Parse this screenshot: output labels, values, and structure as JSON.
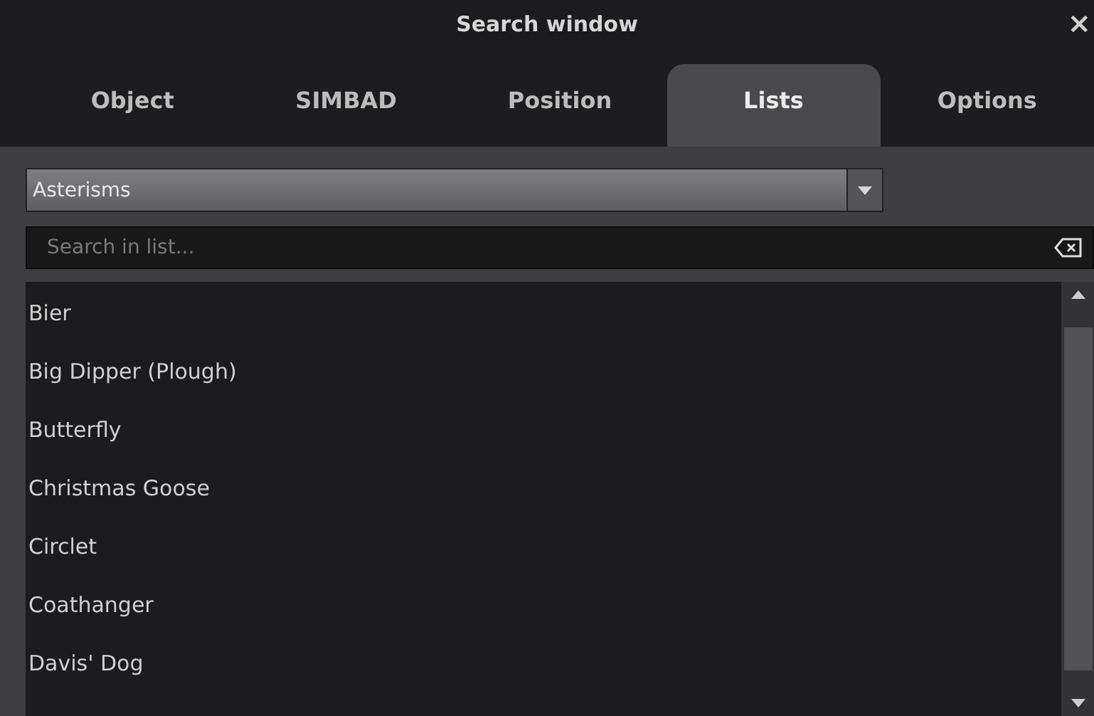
{
  "window": {
    "title": "Search window",
    "close": "×"
  },
  "tabs": [
    {
      "label": "Object",
      "selected": false
    },
    {
      "label": "SIMBAD",
      "selected": false
    },
    {
      "label": "Position",
      "selected": false
    },
    {
      "label": "Lists",
      "selected": true
    },
    {
      "label": "Options",
      "selected": false
    }
  ],
  "list_type": {
    "value": "Asterisms"
  },
  "search": {
    "placeholder": "Search in list..."
  },
  "items": [
    "Bier",
    "Big Dipper (Plough)",
    "Butterfly",
    "Christmas Goose",
    "Circlet",
    "Coathanger",
    "Davis' Dog"
  ]
}
